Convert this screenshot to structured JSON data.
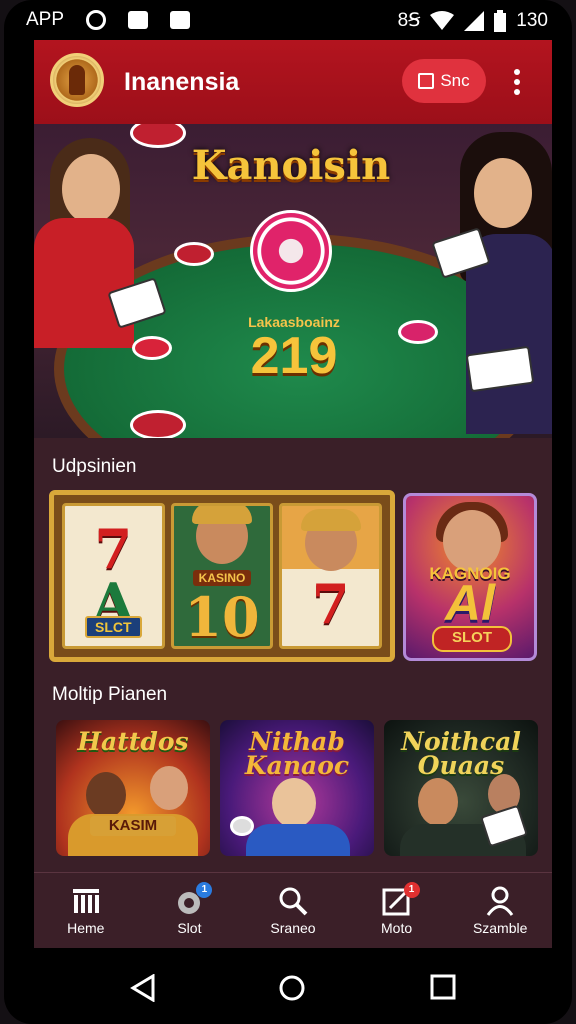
{
  "status_bar": {
    "left_label": "APP",
    "right_label": "8Ꞩ",
    "time": "130"
  },
  "header": {
    "title": "Inanensia",
    "action_button": "Snc"
  },
  "hero": {
    "title": "Kanoisin",
    "subtitle": "Lakaasboainz",
    "number": "219"
  },
  "sections": {
    "first_title": "Udpsinien",
    "second_title": "Moltip Pianen"
  },
  "slot_machine": {
    "reels": [
      {
        "top_symbol": "7",
        "bottom_symbol": "A",
        "banner": "SLCT"
      },
      {
        "label": "KASINO",
        "symbol": "10"
      },
      {
        "symbol": "7"
      }
    ]
  },
  "feature_card": {
    "title": "KAGNOIG",
    "big": "Al",
    "badge": "SLOT"
  },
  "games": [
    {
      "title": "Hattdos",
      "badge": "KASIM",
      "accent": "#f2c94c"
    },
    {
      "title": "Nithab Kanaoc",
      "accent": "#f3b73a"
    },
    {
      "title": "Noithcal Ouaas",
      "accent": "#f0d35a"
    }
  ],
  "bottom_nav": [
    {
      "label": "Heme",
      "icon": "home-grid-icon"
    },
    {
      "label": "Slot",
      "icon": "slot-icon",
      "badge": "1",
      "badge_color": "#2a7be0"
    },
    {
      "label": "Sraneo",
      "icon": "search-icon"
    },
    {
      "label": "Moto",
      "icon": "edit-icon",
      "badge": "1",
      "badge_color": "#e03030"
    },
    {
      "label": "Szamble",
      "icon": "profile-icon"
    }
  ],
  "colors": {
    "header_red": "#b3141f",
    "background": "#3a1f28",
    "gold": "#f6c43b"
  }
}
